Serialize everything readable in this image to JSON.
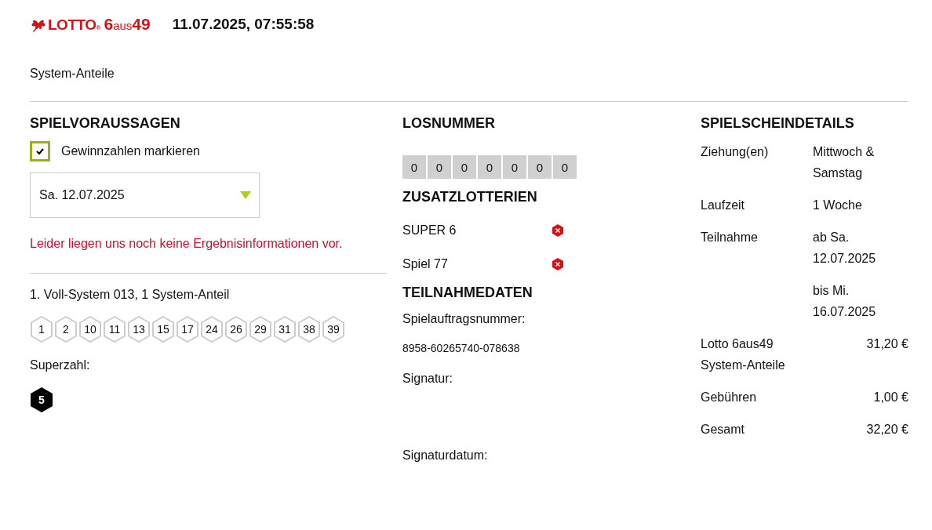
{
  "header": {
    "logo": {
      "brand": "LOTTO",
      "registered": "®",
      "game_number": "6",
      "game_word": "aus",
      "game_max": "49"
    },
    "timestamp": "11.07.2025, 07:55:58"
  },
  "page_title": "System-Anteile",
  "predictions": {
    "heading": "SPIELVORAUSSAGEN",
    "mark_winners": {
      "label": "Gewinnzahlen markieren",
      "checked": true
    },
    "draw_select": {
      "value": "Sa. 12.07.2025"
    },
    "notice": "Leider liegen uns noch keine Ergebnisinformationen vor.",
    "system": {
      "title": "1. Voll-System 013, 1 System-Anteil",
      "numbers": [
        "1",
        "2",
        "10",
        "11",
        "13",
        "15",
        "17",
        "24",
        "26",
        "29",
        "31",
        "38",
        "39"
      ],
      "superzahl_label": "Superzahl:",
      "superzahl": "5"
    }
  },
  "ticket_number": {
    "heading": "LOSNUMMER",
    "digits": [
      "0",
      "0",
      "0",
      "0",
      "0",
      "0",
      "0"
    ]
  },
  "extra_lotteries": {
    "heading": "ZUSATZLOTTERIEN",
    "items": [
      {
        "name": "SUPER 6",
        "participating": false
      },
      {
        "name": "Spiel 77",
        "participating": false
      }
    ]
  },
  "participation": {
    "heading": "TEILNAHMEDATEN",
    "order_number_label": "Spielauftragsnummer:",
    "order_number": "8958-60265740-078638",
    "signature_label": "Signatur:",
    "signature_date_label": "Signaturdatum:"
  },
  "ticket_details": {
    "heading": "SPIELSCHEINDETAILS",
    "rows": [
      {
        "kind": "info",
        "label": "Ziehung(en)",
        "values": [
          "Mittwoch & Samstag"
        ]
      },
      {
        "kind": "info",
        "label": "Laufzeit",
        "values": [
          "1 Woche"
        ]
      },
      {
        "kind": "info",
        "label": "Teilnahme",
        "values": [
          "ab Sa. 12.07.2025",
          "bis Mi. 16.07.2025"
        ]
      },
      {
        "kind": "price",
        "label": "Lotto 6aus49 System-Anteile",
        "values": [
          "31,20 €"
        ]
      },
      {
        "kind": "price",
        "label": "Gebühren",
        "values": [
          "1,00 €"
        ]
      },
      {
        "kind": "price",
        "label": "Gesamt",
        "values": [
          "32,20 €"
        ]
      }
    ]
  }
}
